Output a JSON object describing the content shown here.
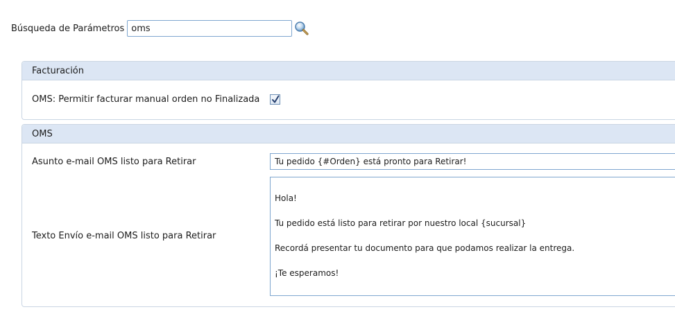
{
  "search": {
    "label": "Búsqueda de Parámetros",
    "value": "oms",
    "icon": "magnifier-icon"
  },
  "panels": {
    "facturacion": {
      "title": "Facturación",
      "fields": {
        "permitir_facturar": {
          "label": "OMS: Permitir facturar manual orden no Finalizada",
          "checked": true
        }
      }
    },
    "oms": {
      "title": "OMS",
      "fields": {
        "asunto": {
          "label": "Asunto e-mail OMS listo para Retirar",
          "value": "Tu pedido {#Orden} está pronto para Retirar!"
        },
        "texto": {
          "label": "Texto Envío e-mail OMS listo para Retirar",
          "lines": [
            "Hola!",
            "Tu pedido está listo para retirar por nuestro local {sucursal}",
            "Recordá presentar tu documento para que podamos realizar la entrega.",
            "¡Te esperamos!"
          ]
        }
      }
    }
  },
  "colors": {
    "panel_header_bg": "#dce6f4",
    "input_border": "#7ea6cf"
  }
}
